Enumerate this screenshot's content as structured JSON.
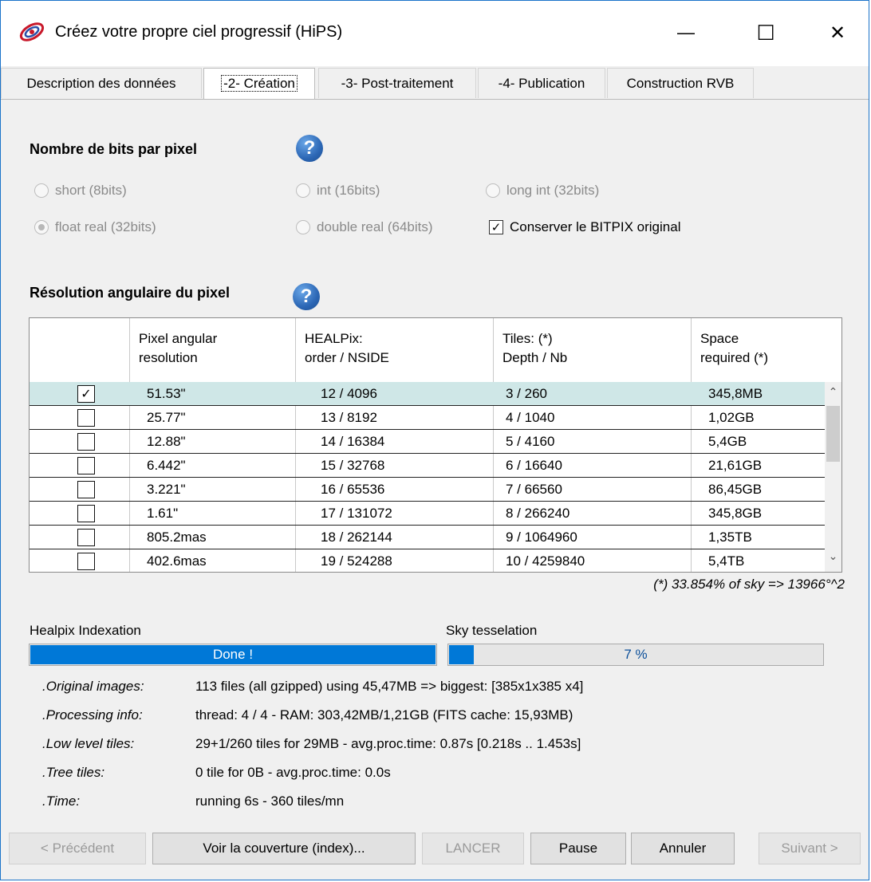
{
  "window": {
    "title": "Créez votre propre ciel progressif (HiPS)"
  },
  "window_controls": {
    "minimize": "—",
    "maximize": "☐",
    "close": "✕"
  },
  "tabs": [
    {
      "label": "Description des données",
      "active": false
    },
    {
      "label": "-2- Création",
      "active": true
    },
    {
      "label": "-3- Post-traitement",
      "active": false
    },
    {
      "label": "-4- Publication",
      "active": false
    },
    {
      "label": "Construction RVB",
      "active": false
    }
  ],
  "bits_section": {
    "title": "Nombre de bits par pixel",
    "help": "?",
    "options": [
      {
        "label": "short (8bits)",
        "selected": false
      },
      {
        "label": "int (16bits)",
        "selected": false
      },
      {
        "label": "long int (32bits)",
        "selected": false
      },
      {
        "label": "float real (32bits)",
        "selected": true
      },
      {
        "label": "double real (64bits)",
        "selected": false
      }
    ],
    "keep_bitpix_label": "Conserver le BITPIX original",
    "keep_bitpix_checked": true
  },
  "resolution_section": {
    "title": "Résolution angulaire du pixel",
    "help": "?",
    "headers": [
      [
        "Pixel angular",
        "resolution"
      ],
      [
        "HEALPix:",
        "order / NSIDE"
      ],
      [
        "Tiles: (*)",
        "Depth / Nb"
      ],
      [
        "Space",
        "required (*)"
      ]
    ],
    "rows": [
      {
        "checked": true,
        "resolution": "51.53\"",
        "healpix": "12 / 4096",
        "tiles": "3 / 260",
        "space": "345,8MB"
      },
      {
        "checked": false,
        "resolution": "25.77\"",
        "healpix": "13 / 8192",
        "tiles": "4 / 1040",
        "space": "1,02GB"
      },
      {
        "checked": false,
        "resolution": "12.88\"",
        "healpix": "14 / 16384",
        "tiles": "5 / 4160",
        "space": "5,4GB"
      },
      {
        "checked": false,
        "resolution": "6.442\"",
        "healpix": "15 / 32768",
        "tiles": "6 / 16640",
        "space": "21,61GB"
      },
      {
        "checked": false,
        "resolution": "3.221\"",
        "healpix": "16 / 65536",
        "tiles": "7 / 66560",
        "space": "86,45GB"
      },
      {
        "checked": false,
        "resolution": "1.61\"",
        "healpix": "17 / 131072",
        "tiles": "8 / 266240",
        "space": "345,8GB"
      },
      {
        "checked": false,
        "resolution": "805.2mas",
        "healpix": "18 / 262144",
        "tiles": "9 / 1064960",
        "space": "1,35TB"
      },
      {
        "checked": false,
        "resolution": "402.6mas",
        "healpix": "19 / 524288",
        "tiles": "10 / 4259840",
        "space": "5,4TB"
      }
    ],
    "check_mark": "✓",
    "scroll_up": "⌃",
    "scroll_down": "⌄",
    "sky_note": "(*) 33.854% of sky => 13966°^2"
  },
  "progress": {
    "indexation": {
      "label": "Healpix Indexation",
      "text": "Done !",
      "fraction": 1.0
    },
    "tesselation": {
      "label": "Sky tesselation",
      "text": "7 %",
      "fraction": 0.07
    }
  },
  "info": [
    {
      "label": ".Original images:",
      "value": "113 files (all gzipped) using 45,47MB => biggest: [385x1x385 x4]"
    },
    {
      "label": ".Processing info:",
      "value": "thread: 4 / 4 - RAM: 303,42MB/1,21GB (FITS cache: 15,93MB)"
    },
    {
      "label": ".Low level tiles:",
      "value": "29+1/260 tiles for 29MB - avg.proc.time: 0.87s [0.218s .. 1.453s]"
    },
    {
      "label": ".Tree tiles:",
      "value": "0 tile for 0B - avg.proc.time: 0.0s"
    },
    {
      "label": ".Time:",
      "value": "running 6s - 360 tiles/mn"
    }
  ],
  "buttons": {
    "previous": "< Précédent",
    "coverage": "Voir la couverture (index)...",
    "launch": "LANCER",
    "pause": "Pause",
    "cancel": "Annuler",
    "next": "Suivant >"
  },
  "colors": {
    "accent": "#0078d7",
    "selected_row": "#cfe7e7",
    "help_icon": "#2c67b5"
  }
}
